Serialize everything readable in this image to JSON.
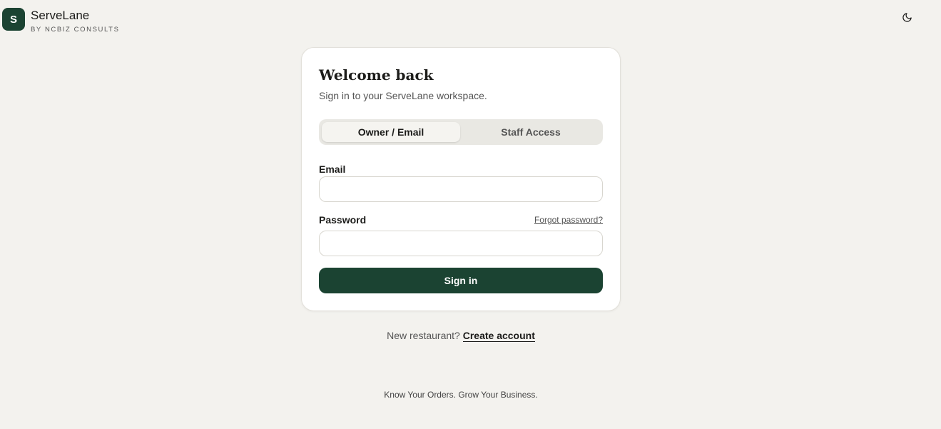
{
  "brand": {
    "logo_letter": "S",
    "name": "ServeLane",
    "subtitle": "BY NCBIZ CONSULTS"
  },
  "header": {
    "theme_icon": "moon-icon"
  },
  "card": {
    "title": "Welcome back",
    "subtitle": "Sign in to your ServeLane workspace.",
    "tabs": [
      {
        "label": "Owner / Email",
        "active": true
      },
      {
        "label": "Staff Access",
        "active": false
      }
    ],
    "email_label": "Email",
    "email_value": "",
    "password_label": "Password",
    "password_value": "",
    "forgot_label": "Forgot password?",
    "signin_label": "Sign in"
  },
  "footer": {
    "new_prompt": "New restaurant?",
    "create_label": "Create account",
    "tagline": "Know Your Orders. Grow Your Business."
  },
  "colors": {
    "accent": "#1b4332",
    "background": "#f3f2ee",
    "card": "#ffffff"
  }
}
